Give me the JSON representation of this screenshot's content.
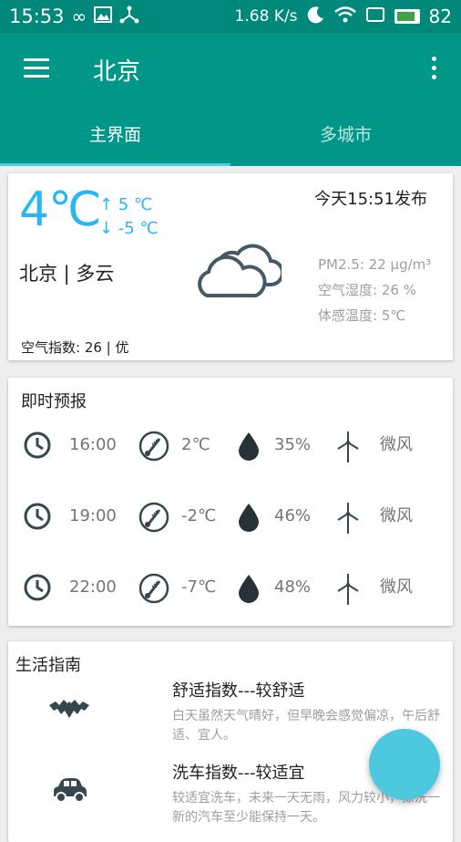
{
  "status_bar": {
    "time": "15:53",
    "net_speed": "1.68 K/s",
    "battery": "82"
  },
  "toolbar": {
    "title": "北京",
    "tabs": [
      {
        "label": "主界面",
        "active": true
      },
      {
        "label": "多城市",
        "active": false
      }
    ]
  },
  "current": {
    "temp": "4℃",
    "high": "↑ 5 ℃",
    "low": "↓ -5 ℃",
    "publish_time": "今天15:51发布",
    "city_weather": "北京 | 多云",
    "pm25": "PM2.5: 22 μg/m³",
    "humidity": "空气湿度: 26 %",
    "feels_like": "体感温度: 5℃",
    "aqi": "空气指数: 26 | 优",
    "icon": "cloudy-icon"
  },
  "forecast": {
    "title": "即时预报",
    "rows": [
      {
        "time": "16:00",
        "temp": "2℃",
        "humidity": "35%",
        "wind": "微风"
      },
      {
        "time": "19:00",
        "temp": "-2℃",
        "humidity": "46%",
        "wind": "微风"
      },
      {
        "time": "22:00",
        "temp": "-7℃",
        "humidity": "48%",
        "wind": "微风"
      }
    ]
  },
  "guide": {
    "title": "生活指南",
    "items": [
      {
        "title": "舒适指数---较舒适",
        "desc": "白天虽然天气晴好，但早晚会感觉偏凉，午后舒适、宜人。",
        "icon": "bat-icon"
      },
      {
        "title": "洗车指数---较适宜",
        "desc": "较适宜洗车，未来一天无雨，风力较小，擦洗一新的汽车至少能保持一天。",
        "icon": "car-icon"
      }
    ]
  },
  "colors": {
    "primary": "#009688",
    "status_bar": "#00897b",
    "accent": "#29b6f6",
    "fab": "#4dc8df"
  }
}
